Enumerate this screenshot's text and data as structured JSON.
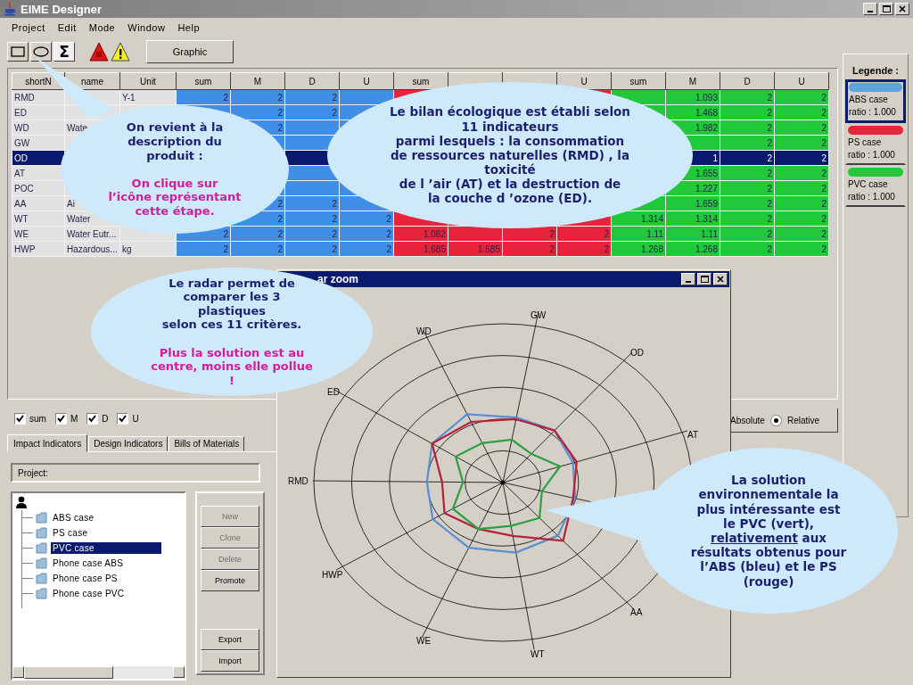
{
  "window": {
    "title": "EIME Designer"
  },
  "menu": [
    "Project",
    "Edit",
    "Mode",
    "Window",
    "Help"
  ],
  "toolbar": {
    "tools": [
      {
        "kind": "rectangle"
      },
      {
        "kind": "ellipse"
      },
      {
        "kind": "symbol",
        "label": "Σ"
      }
    ],
    "alerts": [
      {
        "kind": "error"
      },
      {
        "kind": "warning"
      }
    ],
    "graphic_button": "Graphic"
  },
  "table": {
    "columns": [
      {
        "kind": "text",
        "label": "shortN"
      },
      {
        "kind": "text",
        "label": "name"
      },
      {
        "kind": "text",
        "label": "Unit"
      },
      {
        "kind": "abs",
        "label": "sum"
      },
      {
        "kind": "abs",
        "label": "M"
      },
      {
        "kind": "abs",
        "label": "D"
      },
      {
        "kind": "abs",
        "label": "U"
      },
      {
        "kind": "ps",
        "label": "sum"
      },
      {
        "kind": "ps"
      },
      {
        "kind": "ps"
      },
      {
        "kind": "ps",
        "label": "U"
      },
      {
        "kind": "pvc",
        "label": "sum"
      },
      {
        "kind": "pvc",
        "label": "M"
      },
      {
        "kind": "pvc",
        "label": "D"
      },
      {
        "kind": "pvc",
        "label": "U"
      }
    ],
    "rows": [
      {
        "selected": false,
        "cells": [
          "RMD",
          null,
          "Y-1",
          "2",
          "2",
          "2",
          null,
          null,
          null,
          null,
          null,
          null,
          "1.093",
          "2",
          "2"
        ]
      },
      {
        "selected": false,
        "cells": [
          "ED",
          null,
          null,
          null,
          "2",
          "2",
          null,
          null,
          null,
          null,
          null,
          null,
          "1.468",
          "2",
          "2"
        ]
      },
      {
        "selected": false,
        "cells": [
          "WD",
          "Wate",
          null,
          null,
          "2",
          null,
          null,
          null,
          null,
          null,
          null,
          null,
          "1.982",
          "2",
          "2"
        ]
      },
      {
        "selected": false,
        "cells": [
          "GW",
          null,
          null,
          null,
          null,
          null,
          null,
          null,
          null,
          null,
          null,
          null,
          null,
          "2",
          "2"
        ]
      },
      {
        "selected": true,
        "cells": [
          "OD",
          null,
          null,
          null,
          null,
          null,
          null,
          null,
          null,
          null,
          null,
          null,
          "1",
          "2",
          "2"
        ]
      },
      {
        "selected": false,
        "cells": [
          "AT",
          null,
          null,
          null,
          null,
          null,
          null,
          null,
          null,
          null,
          null,
          null,
          "1.655",
          "2",
          "2"
        ]
      },
      {
        "selected": false,
        "cells": [
          "POC",
          null,
          null,
          null,
          null,
          null,
          null,
          null,
          null,
          null,
          null,
          null,
          "1.227",
          "2",
          "2"
        ]
      },
      {
        "selected": false,
        "cells": [
          "AA",
          "Ai",
          null,
          null,
          "2",
          "2",
          null,
          null,
          null,
          null,
          null,
          null,
          "1.659",
          "2",
          "2"
        ]
      },
      {
        "selected": false,
        "cells": [
          "WT",
          "Water",
          null,
          null,
          "2",
          "2",
          "2",
          null,
          null,
          null,
          null,
          "1.314",
          "1.314",
          "2",
          "2"
        ]
      },
      {
        "selected": false,
        "cells": [
          "WE",
          "Water Eutr...",
          null,
          "2",
          "2",
          "2",
          "2",
          "1.082",
          null,
          "2",
          "2",
          "1.11",
          "1.11",
          "2",
          "2"
        ]
      },
      {
        "selected": false,
        "cells": [
          "HWP",
          "Hazardous...",
          "kg",
          "2",
          "2",
          "2",
          "2",
          "1.685",
          "1.685",
          "2",
          "2",
          "1.268",
          "1.268",
          "2",
          "2"
        ]
      }
    ]
  },
  "checkboxes": [
    {
      "label": "sum",
      "checked": true
    },
    {
      "label": "M",
      "checked": true
    },
    {
      "label": "D",
      "checked": true
    },
    {
      "label": "U",
      "checked": true
    }
  ],
  "tabs": [
    {
      "label": "Impact Indicators",
      "selected": true
    },
    {
      "label": "Design Indicators",
      "selected": false
    },
    {
      "label": "Bills of Materials",
      "selected": false
    }
  ],
  "project_field": {
    "label": "Project:"
  },
  "tree": {
    "children": [
      {
        "label": "ABS case",
        "selected": false
      },
      {
        "label": "PS case",
        "selected": false
      },
      {
        "label": "PVC case",
        "selected": true
      },
      {
        "label": "Phone case ABS",
        "selected": false
      },
      {
        "label": "Phone case PS",
        "selected": false
      },
      {
        "label": "Phone case PVC",
        "selected": false
      }
    ]
  },
  "buttons": [
    {
      "label": "New",
      "disabled": true
    },
    {
      "label": "Clone",
      "disabled": true
    },
    {
      "label": "Delete",
      "disabled": true
    },
    {
      "label": "Promote",
      "disabled": false
    },
    {
      "label": "Export",
      "disabled": false
    },
    {
      "label": "Import",
      "disabled": false
    }
  ],
  "view_mode": {
    "absolute_label": "Absolute",
    "options": [
      {
        "label": "Relative",
        "selected": true
      }
    ]
  },
  "legend": {
    "title": "Legende :",
    "items": [
      {
        "name": "ABS case",
        "ratio": "ratio : 1.000",
        "color": "#5fa3dc",
        "selected": true
      },
      {
        "name": "PS case",
        "ratio": "ratio : 1.000",
        "color": "#e8233c",
        "selected": false
      },
      {
        "name": "PVC case",
        "ratio": "ratio : 1.000",
        "color": "#20c83a",
        "selected": false
      }
    ]
  },
  "radar_window": {
    "title": "ar zoom",
    "axis_labels": [
      "GW",
      "OD",
      "AT",
      "AA",
      "WT",
      "WE",
      "HWP",
      "RMD",
      "ED",
      "WD"
    ]
  },
  "callouts": [
    {
      "paragraphs": [
        {
          "kind": "note",
          "segments": [
            {
              "text": "On revient à la\ndescription du\nproduit :",
              "underline": false
            }
          ]
        },
        {
          "kind": "emphasis",
          "segments": [
            {
              "text": "On clique sur\nl’icône représentant\ncette étape.",
              "underline": false
            }
          ]
        }
      ]
    },
    {
      "paragraphs": [
        {
          "kind": "note",
          "segments": [
            {
              "text": "Le bilan écologique est établi selon\n11 indicateurs\nparmi lesquels : la consommation\nde ressources naturelles (RMD) , la\ntoxicité\nde l ’air (AT) et la destruction de\nla couche d ’ozone (ED).",
              "underline": false
            }
          ]
        }
      ]
    },
    {
      "paragraphs": [
        {
          "kind": "note",
          "segments": [
            {
              "text": "Le radar permet de\ncomparer les 3\nplastiques\nselon ces 11 critères.",
              "underline": false
            }
          ]
        },
        {
          "kind": "emphasis",
          "segments": [
            {
              "text": "Plus la solution est au\ncentre, moins elle pollue\n!",
              "underline": false
            }
          ]
        }
      ]
    },
    {
      "paragraphs": [
        {
          "kind": "note",
          "segments": [
            {
              "text": "La solution\nenvironnementale la\nplus intéressante est\nle PVC (vert),\n",
              "underline": false
            },
            {
              "text": "relativement",
              "underline": true
            },
            {
              "text": " aux\nrésultats obtenus pour\nl’ABS (bleu) et le PS\n(rouge)",
              "underline": false
            }
          ]
        }
      ]
    }
  ]
}
